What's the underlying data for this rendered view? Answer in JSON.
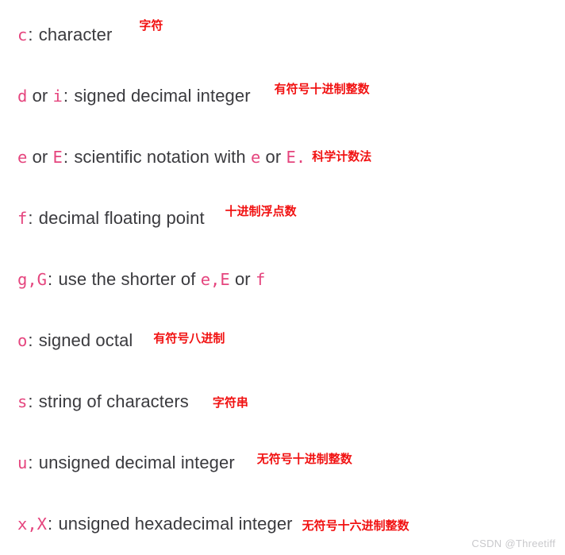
{
  "page": {
    "background_color": "#ffffff",
    "body_text_color": "#3a3a3e",
    "code_color": "#e5457e",
    "annotation_color": "#f11212",
    "watermark_color": "#c9c9cc"
  },
  "watermark": {
    "text": "CSDN @Threetiff"
  },
  "lines": [
    {
      "specifier": "c",
      "separator": ":",
      "description": "character",
      "annotation": "字符"
    },
    {
      "specifier": "d",
      "conjunction": "or",
      "specifier2": "i",
      "separator": ":",
      "description": "signed decimal integer",
      "annotation": "有符号十进制整数"
    },
    {
      "specifier": "e",
      "conjunction": "or",
      "specifier2": "E",
      "separator": ":",
      "desc_pre": "scientific notation with",
      "inline_code_1": "e",
      "inline_mid": "or",
      "inline_code_2": "E",
      "desc_post": ".",
      "annotation": "科学计数法"
    },
    {
      "specifier": "f",
      "separator": ":",
      "description": "decimal floating point",
      "annotation": "十进制浮点数"
    },
    {
      "specifier": "g,G",
      "separator": ":",
      "desc_pre": "use the shorter of",
      "inline_code_1": "e,E",
      "inline_mid": "or",
      "inline_code_2": "f",
      "annotation": ""
    },
    {
      "specifier": "o",
      "separator": ":",
      "description": "signed octal",
      "annotation": "有符号八进制"
    },
    {
      "specifier": "s",
      "separator": ":",
      "description": "string of characters",
      "annotation": "字符串"
    },
    {
      "specifier": "u",
      "separator": ":",
      "description": "unsigned decimal integer",
      "annotation": "无符号十进制整数"
    },
    {
      "specifier": "x,X",
      "separator": ":",
      "description": "unsigned hexadecimal integer",
      "annotation": "无符号十六进制整数"
    }
  ]
}
